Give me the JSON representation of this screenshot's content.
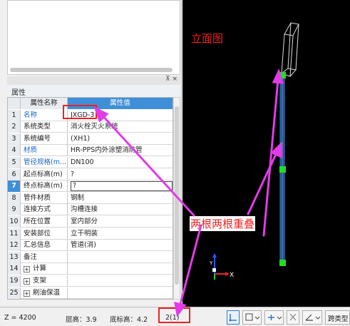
{
  "panel": {
    "title": "属性",
    "pin": "⊼ ×"
  },
  "table": {
    "headers": [
      "属性名称",
      "属性值"
    ],
    "rows": [
      {
        "num": "1",
        "name": "名称",
        "value": "JXGD-3",
        "blue": true
      },
      {
        "num": "2",
        "name": "系统类型",
        "value": "消火栓灭火系统",
        "blue": false
      },
      {
        "num": "3",
        "name": "系统编号",
        "value": "(XH1)",
        "blue": false
      },
      {
        "num": "4",
        "name": "材质",
        "value": "HR-PPS内外涂塑消防管",
        "blue": true
      },
      {
        "num": "5",
        "name": "管径规格(m...",
        "value": "DN100",
        "blue": true
      },
      {
        "num": "6",
        "name": "起点标高(m)",
        "value": "?",
        "blue": false
      },
      {
        "num": "7",
        "name": "终点标高(m)",
        "value": "?",
        "blue": false
      },
      {
        "num": "8",
        "name": "管件材质",
        "value": "钢制",
        "blue": false
      },
      {
        "num": "9",
        "name": "连接方式",
        "value": "沟槽连接",
        "blue": false
      },
      {
        "num": "10",
        "name": "所在位置",
        "value": "室内部分",
        "blue": false
      },
      {
        "num": "11",
        "name": "安装部位",
        "value": "立干明装",
        "blue": false
      },
      {
        "num": "12",
        "name": "汇总信息",
        "value": "管道(消)",
        "blue": false
      },
      {
        "num": "13",
        "name": "备注",
        "value": "",
        "blue": false
      },
      {
        "num": "14",
        "name": "计算",
        "value": "",
        "blue": false
      },
      {
        "num": "19",
        "name": "支架",
        "value": "",
        "blue": false
      },
      {
        "num": "25",
        "name": "刷油保温",
        "value": "",
        "blue": false
      }
    ]
  },
  "status": {
    "z": "Z = 4200",
    "floor_height": "层高：3.9",
    "base_elevation": "底标高：4.2",
    "selection_count": "2(1)",
    "cross_layer": "跨类型"
  },
  "viewport": {
    "axis_x": "X",
    "axis_y": "Y"
  },
  "annotations": {
    "elevation_view": "立面图",
    "overlap_note": "两根两根重叠"
  },
  "colors": {
    "selection_blue": "#3f8fd8",
    "annotation_red": "#ee2222",
    "arrow_magenta": "#e23be8",
    "node_green": "#22dd22",
    "pipe_blue": "#1f4f86"
  },
  "icons": [
    "pin-icon",
    "close-icon",
    "expand-plus-icon",
    "axis-gizmo-icon",
    "snap-icon",
    "box-icon",
    "add-icon",
    "cross-icon",
    "angle-icon"
  ]
}
